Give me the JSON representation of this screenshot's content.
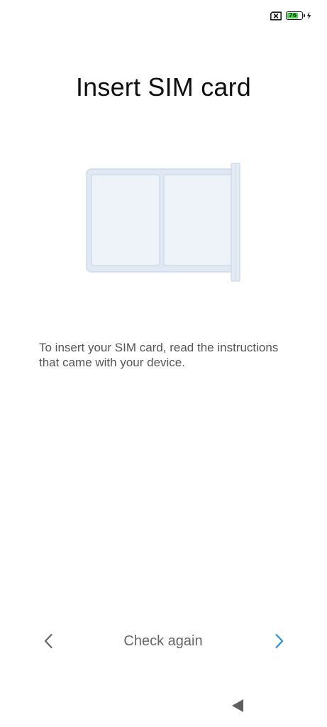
{
  "status_bar": {
    "battery_level": "76",
    "battery_fraction": 0.76,
    "battery_color": "#4fd14f",
    "icons": [
      "no-sim-icon",
      "battery-icon",
      "charging-icon"
    ]
  },
  "title": "Insert SIM card",
  "illustration": {
    "icon": "sim-tray-icon",
    "tray_color": "#dfe8f3",
    "slot_color": "#eef3f9",
    "slot_count": 2
  },
  "instructions": "To insert your SIM card, read the instructions that came with your device.",
  "navigation": {
    "prev_icon": "chevron-left-icon",
    "check_again_label": "Check again",
    "next_icon": "chevron-right-icon",
    "next_color": "#2d8fe0"
  },
  "system_nav": {
    "back_icon": "back-triangle-icon"
  }
}
